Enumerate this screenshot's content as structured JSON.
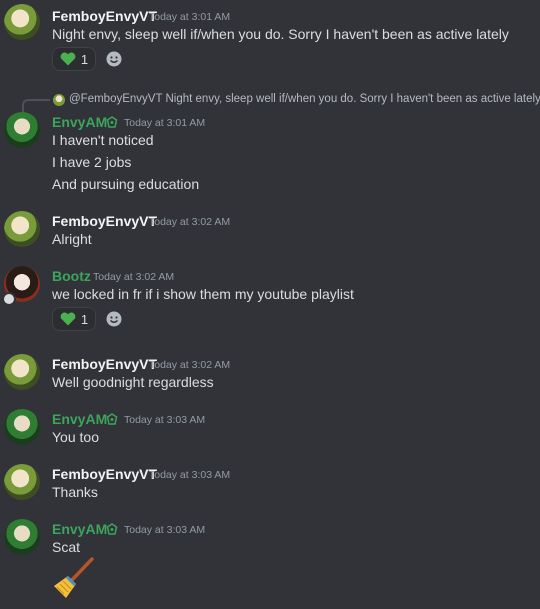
{
  "messages": [
    {
      "author": "FemboyEnvyVT",
      "time": "Today at 3:01 AM",
      "lines": [
        "Night envy, sleep well if/when you do. Sorry I haven't been as active lately"
      ],
      "reaction": {
        "emoji": "green-heart",
        "count": "1"
      }
    },
    {
      "reply": {
        "mention": "@FemboyEnvyVT",
        "text": "Night envy, sleep well if/when you do. Sorry I haven't been as active lately"
      },
      "author": "EnvyAM",
      "time": "Today at 3:01 AM",
      "lines": [
        "I haven't noticed",
        "I have 2 jobs",
        "And pursuing education"
      ]
    },
    {
      "author": "FemboyEnvyVT",
      "time": "Today at 3:02 AM",
      "lines": [
        "Alright"
      ]
    },
    {
      "author": "Bootz",
      "time": "Today at 3:02 AM",
      "lines": [
        "we locked in fr if i show them my youtube playlist"
      ],
      "reaction": {
        "emoji": "green-heart",
        "count": "1"
      }
    },
    {
      "author": "FemboyEnvyVT",
      "time": "Today at 3:02 AM",
      "lines": [
        "Well goodnight regardless"
      ]
    },
    {
      "author": "EnvyAM",
      "time": "Today at 3:03 AM",
      "lines": [
        "You too"
      ]
    },
    {
      "author": "FemboyEnvyVT",
      "time": "Today at 3:03 AM",
      "lines": [
        "Thanks"
      ]
    },
    {
      "author": "EnvyAM",
      "time": "Today at 3:03 AM",
      "lines": [
        "Scat"
      ],
      "attachment": "broom-emoji"
    }
  ],
  "colors": {
    "background": "#313338",
    "author_green": "#3ba55c",
    "heart": "#4caf50"
  }
}
